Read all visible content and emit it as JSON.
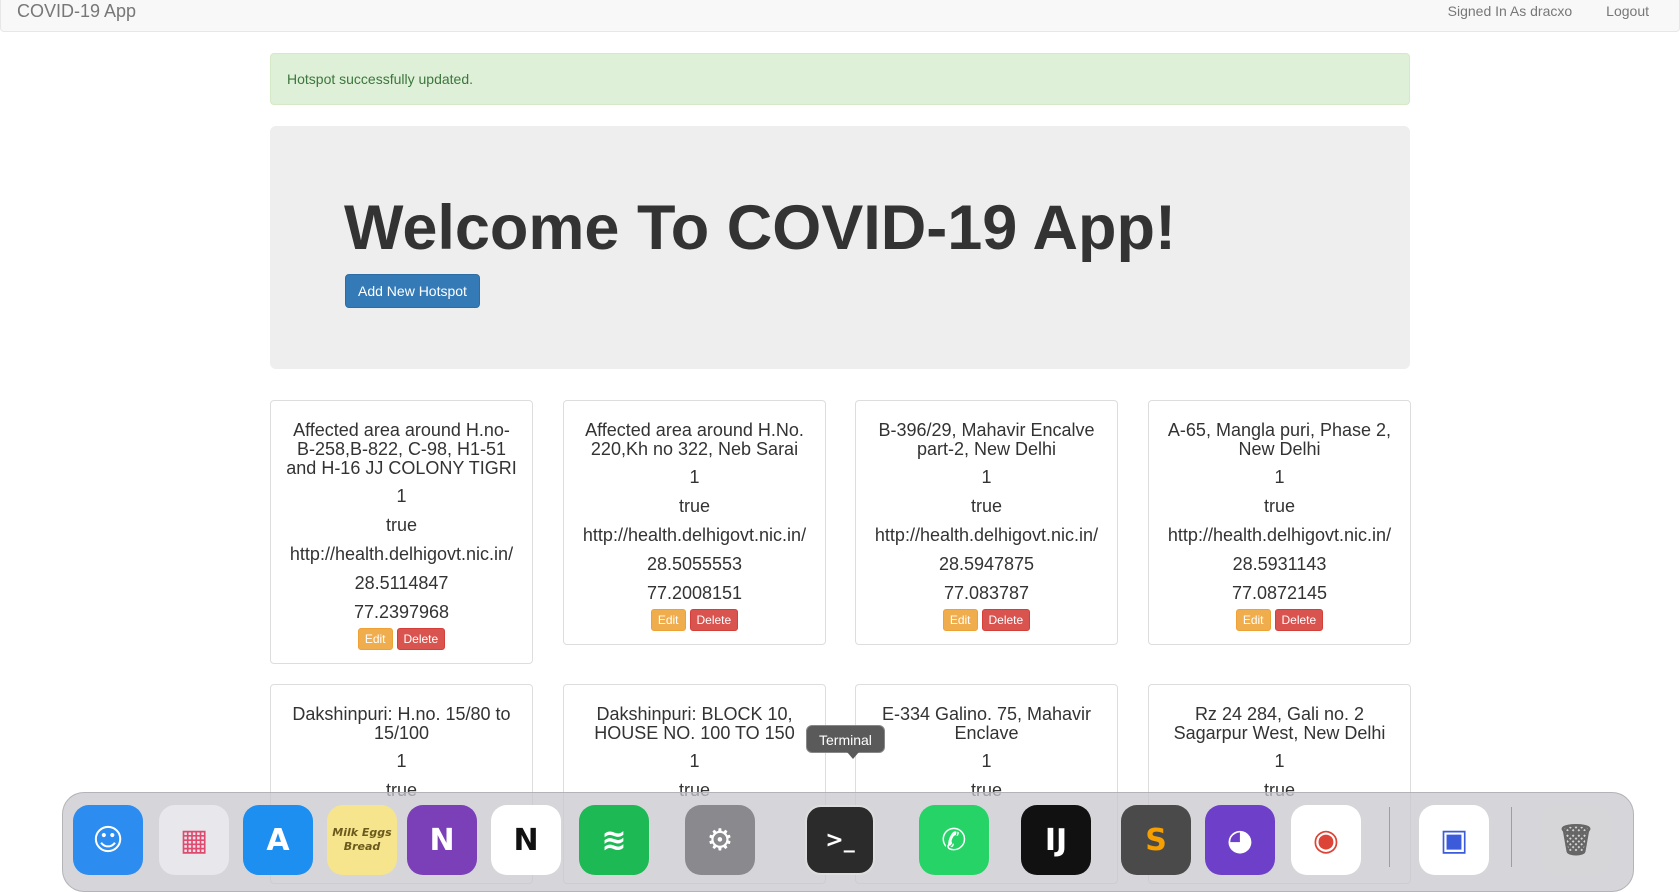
{
  "navbar": {
    "brand": "COVID-19 App",
    "signed_in": "Signed In As dracxo",
    "logout": "Logout"
  },
  "alert": {
    "message": "Hotspot successfully updated."
  },
  "jumbotron": {
    "heading": "Welcome To COVID-19 App!",
    "add_button": "Add New Hotspot"
  },
  "card_buttons": {
    "edit": "Edit",
    "delete": "Delete"
  },
  "hotspots": [
    {
      "title": "Affected area around H.no-B-258,B-822, C-98, H1-51 and H-16 JJ COLONY TIGRI",
      "count": "1",
      "status": "true",
      "url": "http://health.delhigovt.nic.in/",
      "lat": "28.5114847",
      "lng": "77.2397968"
    },
    {
      "title": "Affected area around H.No. 220,Kh no 322, Neb Sarai",
      "count": "1",
      "status": "true",
      "url": "http://health.delhigovt.nic.in/",
      "lat": "28.5055553",
      "lng": "77.2008151"
    },
    {
      "title": "B-396/29, Mahavir Encalve part-2, New Delhi",
      "count": "1",
      "status": "true",
      "url": "http://health.delhigovt.nic.in/",
      "lat": "28.5947875",
      "lng": "77.083787"
    },
    {
      "title": "A-65, Mangla puri, Phase 2, New Delhi",
      "count": "1",
      "status": "true",
      "url": "http://health.delhigovt.nic.in/",
      "lat": "28.5931143",
      "lng": "77.0872145"
    },
    {
      "title": "Dakshinpuri: H.no. 15/80 to 15/100",
      "count": "1",
      "status": "true"
    },
    {
      "title": "Dakshinpuri: BLOCK 10, HOUSE NO. 100 TO 150",
      "count": "1",
      "status": "true"
    },
    {
      "title": "E-334 Galino. 75, Mahavir Enclave",
      "count": "1",
      "status": "true"
    },
    {
      "title": "Rz 24 284, Gali no. 2 Sagarpur West, New Delhi",
      "count": "1",
      "status": "true"
    }
  ],
  "tooltip": {
    "text": "Terminal"
  },
  "dock": {
    "items": [
      {
        "name": "finder-icon",
        "glyph": "☺",
        "color": "#2d8cf0"
      },
      {
        "name": "launchpad-icon",
        "glyph": "▦",
        "color": "#e8e8ec"
      },
      {
        "name": "app-store-icon",
        "glyph": "A",
        "color": "#1c8ff0"
      },
      {
        "name": "stickies-icon",
        "glyph": "Milk Eggs Bread",
        "color": "#f6e58d"
      },
      {
        "name": "onenote-icon",
        "glyph": "N",
        "color": "#7b3fb8"
      },
      {
        "name": "notion-icon",
        "glyph": "N",
        "color": "#ffffff"
      },
      {
        "name": "spotify-icon",
        "glyph": "≋",
        "color": "#1db954"
      },
      {
        "name": "system-preferences-icon",
        "glyph": "⚙",
        "color": "#8a8a8e"
      },
      {
        "name": "terminal-icon",
        "glyph": ">_",
        "color": "#2b2b2b"
      },
      {
        "name": "whatsapp-icon",
        "glyph": "✆",
        "color": "#25d366"
      },
      {
        "name": "intellij-icon",
        "glyph": "IJ",
        "color": "#111111"
      },
      {
        "name": "sublime-text-icon",
        "glyph": "S",
        "color": "#4a4a4a"
      },
      {
        "name": "github-desktop-icon",
        "glyph": "◕",
        "color": "#6e40c9"
      },
      {
        "name": "chrome-icon",
        "glyph": "◉",
        "color": "#ffffff"
      },
      {
        "name": "screen-capture-icon",
        "glyph": "▣",
        "color": "#ffffff"
      },
      {
        "name": "trash-icon",
        "glyph": "🗑",
        "color": "#d6d6d8"
      }
    ]
  }
}
